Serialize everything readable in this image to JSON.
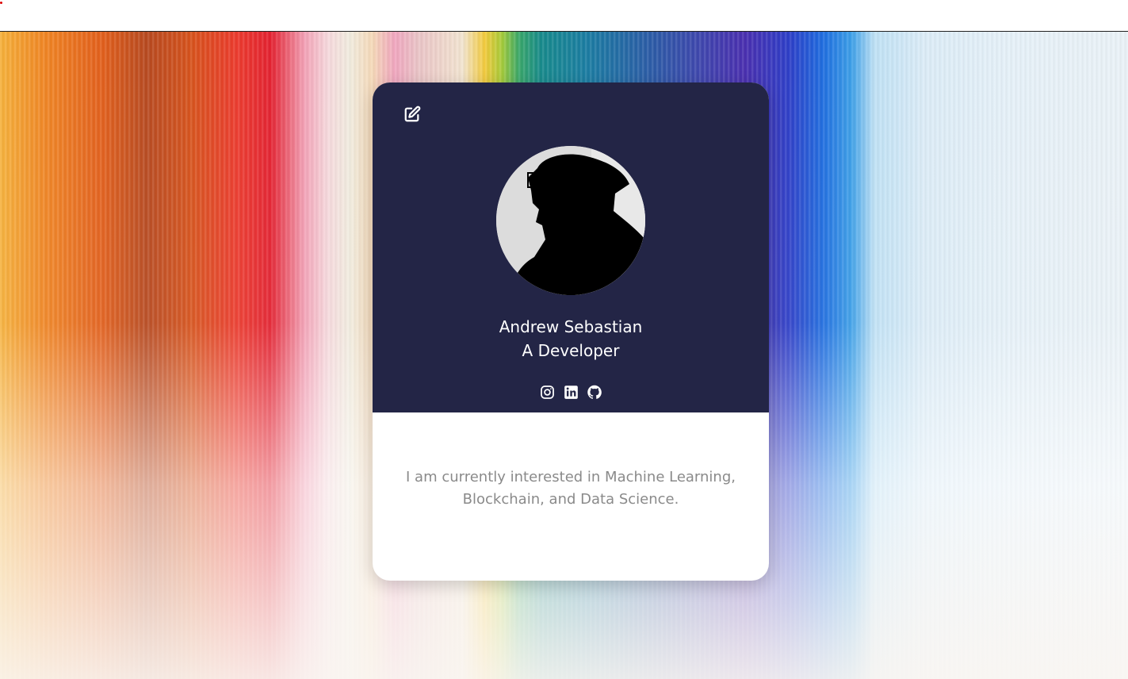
{
  "profile": {
    "name": "Andrew Sebastian",
    "role": "A Developer",
    "bio": "I am currently interested in Machine Learning, Blockchain, and Data Science."
  },
  "icons": {
    "edit": "edit-icon",
    "avatar": "person-silhouette",
    "socials": [
      "instagram-icon",
      "linkedin-icon",
      "github-icon"
    ]
  },
  "colors": {
    "card_header": "#232546",
    "card_body": "#ffffff",
    "bio_text": "#8a8a8a",
    "header_text": "#ffffff"
  }
}
